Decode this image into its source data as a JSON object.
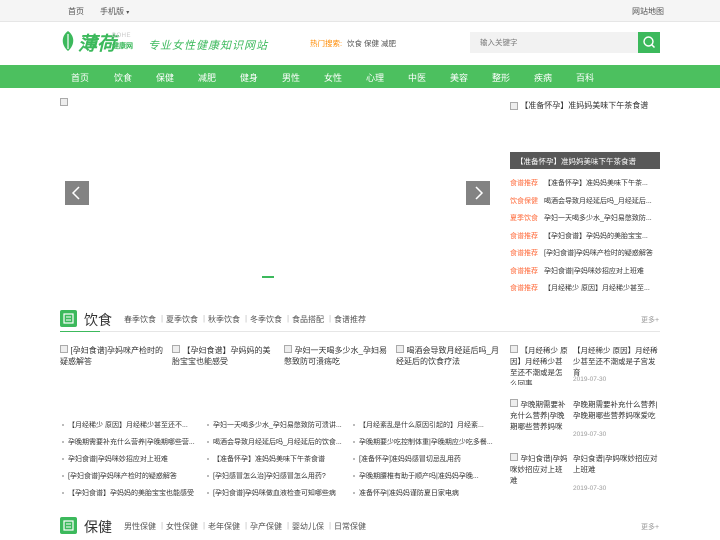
{
  "topbar": {
    "home": "首页",
    "mobile": "手机版",
    "mobile_arrow": "▾",
    "sitemap": "网站地图"
  },
  "header": {
    "logo_main": "薄荷",
    "logo_en": "BOHE",
    "logo_cn": "健康网",
    "slogan": "专业女性健康知识网站",
    "hot_label": "热门搜索:",
    "hot_items": [
      "饮食",
      "保健",
      "减肥"
    ],
    "search_placeholder": "输入关键字"
  },
  "nav": [
    "首页",
    "饮食",
    "保健",
    "减肥",
    "健身",
    "男性",
    "女性",
    "心理",
    "中医",
    "美容",
    "整形",
    "疾病",
    "百科"
  ],
  "banner": {
    "prev_icon": "‹",
    "next_icon": "›"
  },
  "right_top": {
    "headline": "【准备怀孕】准妈妈美味下午茶食谱",
    "caption": "【准备怀孕】准妈妈美味下午茶食谱",
    "list": [
      {
        "tag": "食谱推荐",
        "text": "【准备怀孕】准妈妈美味下午茶..."
      },
      {
        "tag": "饮食保健",
        "text": "喝酒会导致月经延后吗_月经延后..."
      },
      {
        "tag": "夏季饮食",
        "text": "孕妇一天喝多少水_孕妇易憋致防..."
      },
      {
        "tag": "食谱推荐",
        "text": "【孕妇食谱】孕妈妈的美胎宝宝..."
      },
      {
        "tag": "食谱推荐",
        "text": "[孕妇食谱]孕妈咪产检时的疑惑解答"
      },
      {
        "tag": "食谱推荐",
        "text": "孕妇食谱|孕妈咪妙招应对上班难"
      },
      {
        "tag": "食谱推荐",
        "text": "【月经稀少 原因】月经稀少甚至..."
      }
    ]
  },
  "food": {
    "title": "饮食",
    "subs": [
      "春季饮食",
      "夏季饮食",
      "秋季饮食",
      "冬季饮食",
      "食品搭配",
      "食谱推荐"
    ],
    "more": "更多+",
    "cards": [
      "[孕妇食谱]孕妈咪产检时的疑惑解答",
      "【孕妇食谱】孕妈妈的美胎宝宝也能感受",
      "孕妇一天喝多少水_孕妇易憋致防可溃疡吃",
      "喝酒会导致月经延后吗_月经延后的饮食疗法"
    ],
    "col1": [
      "【月经稀少 原因】月经稀少甚至还不...",
      "孕晚期需要补充什么营养|孕晚期哪些营...",
      "孕妇食谱|孕妈咪妙招应对上班难",
      "[孕妇食谱]孕妈咪产检时的疑惑解答",
      "【孕妇食谱】孕妈妈的美胎宝宝也能感受"
    ],
    "col2": [
      "孕妇一天喝多少水_孕妇易憋致防可溃讲...",
      "喝酒会导致月经延后吗_月经延后的饮食...",
      "【准备怀孕】准妈妈美味下午茶食谱",
      "[孕妇感冒怎么治]孕妇感冒怎么用药?",
      "[孕妇食谱]孕妈咪做血液检查可知哪些病"
    ],
    "col3": [
      "【月经紊乱是什么原因引起的】月经紊...",
      "孕晚期要少吃控制体重|孕晚期应少吃多餐...",
      "[准备怀孕]准妈妈感冒切忌乱用药",
      "孕晚期腰椎有助于顺产吗|准妈妈孕晚...",
      "准备怀孕|准妈妈谨防夏日家电病"
    ],
    "right": [
      {
        "alt": "【月经稀少 原因】月经稀少甚至还不潮或是怎么回事",
        "title": "【月经稀少 原因】月经稀少甚至还不潮或是子宫发育",
        "date": "2019-07-30"
      },
      {
        "alt": "孕晚期需要补充什么营养|孕晚期哪些营养妈咪",
        "title": "孕晚期需要补充什么营养|孕晚期哪些营养妈咪爱吃",
        "date": "2019-07-30"
      },
      {
        "alt": "孕妇食谱|孕妈咪妙招应对上班难",
        "title": "孕妇食谱|孕妈咪妙招应对上班难",
        "date": "2019-07-30"
      }
    ]
  },
  "care": {
    "title": "保健",
    "subs": [
      "男性保健",
      "女性保健",
      "老年保健",
      "孕产保健",
      "婴幼儿保",
      "日常保健"
    ],
    "more": "更多+"
  },
  "colors": {
    "brand_green": "#3cb95c",
    "nav_green": "#4cc05f",
    "tag_orange": "#ff6a3a"
  },
  "icons": {
    "search": "search-icon",
    "prev": "chevron-left-icon",
    "next": "chevron-right-icon",
    "section": "section-book-icon"
  }
}
